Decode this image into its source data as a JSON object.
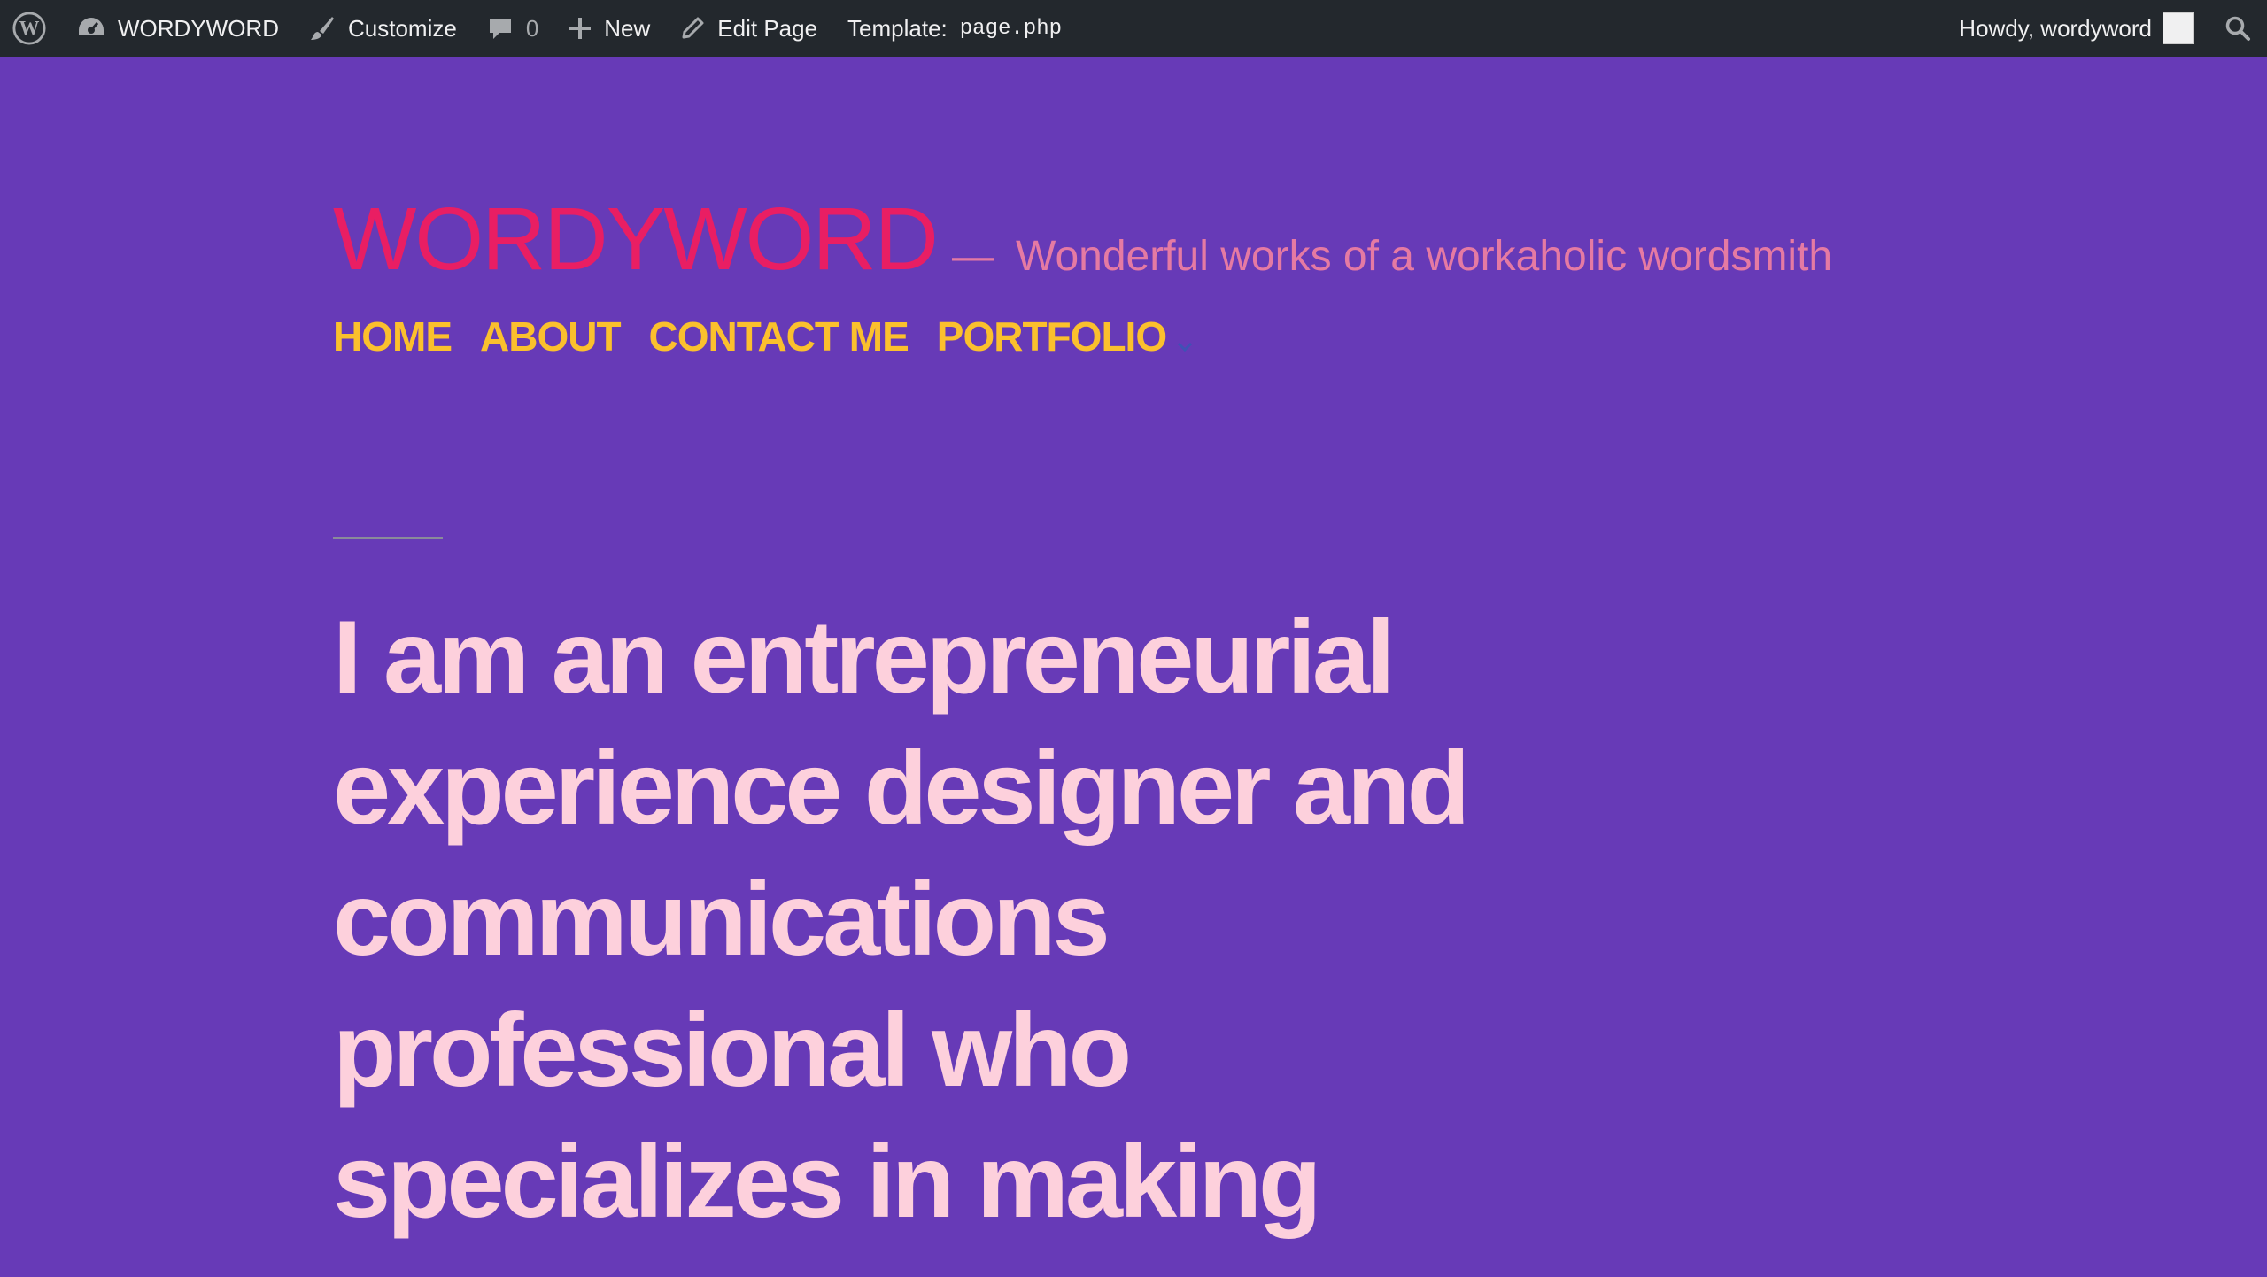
{
  "admin_bar": {
    "site_name": "WORDYWORD",
    "customize": "Customize",
    "comments_count": "0",
    "new": "New",
    "edit_page": "Edit Page",
    "template_label": "Template:",
    "template_file": "page.php",
    "howdy": "Howdy, wordyword"
  },
  "header": {
    "site_title": "WORDYWORD",
    "tagline_dash": "—",
    "tagline": "Wonderful works of a workaholic wordsmith"
  },
  "menu": {
    "items": [
      "HOME",
      "ABOUT",
      "CONTACT ME",
      "PORTFOLIO"
    ]
  },
  "content": {
    "headline": "I am an entrepreneurial experience designer and communications professional who specializes in making"
  },
  "colors": {
    "background": "#673ab7",
    "admin_bar": "#23282d",
    "site_title": "#e91e63",
    "tagline": "#e57aa3",
    "menu": "#fbc02d",
    "headline": "#fdd0dc"
  }
}
